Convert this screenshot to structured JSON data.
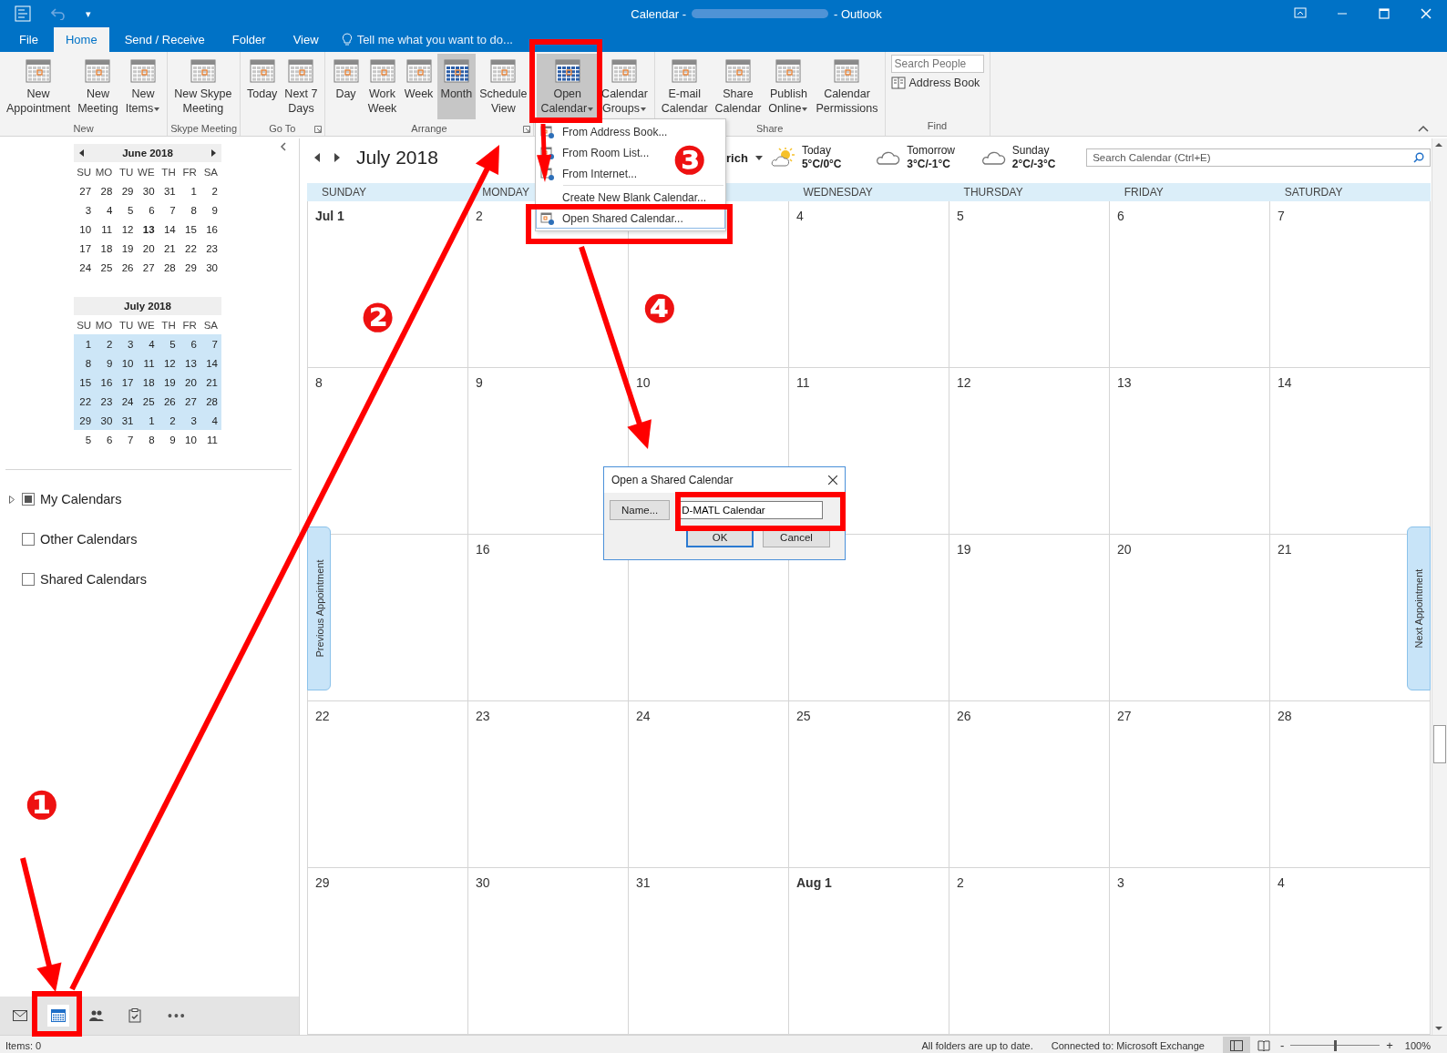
{
  "window": {
    "title_start": "Calendar -",
    "title_end": "- Outlook"
  },
  "quick_access": {
    "customize": "▾"
  },
  "tabs": [
    {
      "label": "File",
      "selected": false
    },
    {
      "label": "Home",
      "selected": true
    },
    {
      "label": "Send / Receive",
      "selected": false
    },
    {
      "label": "Folder",
      "selected": false
    },
    {
      "label": "View",
      "selected": false
    }
  ],
  "tell_me": {
    "placeholder": "Tell me what you want to do..."
  },
  "ribbon": {
    "groups": [
      {
        "label": "New",
        "launcher": false,
        "buttons": [
          {
            "lines": [
              "New",
              "Appointment"
            ],
            "menu": false,
            "selected": false
          },
          {
            "lines": [
              "New",
              "Meeting"
            ],
            "menu": false,
            "selected": false
          },
          {
            "lines": [
              "New",
              "Items"
            ],
            "menu": true,
            "selected": false
          }
        ]
      },
      {
        "label": "Skype Meeting",
        "launcher": false,
        "buttons": [
          {
            "lines": [
              "New Skype",
              "Meeting"
            ],
            "menu": false,
            "selected": false
          }
        ]
      },
      {
        "label": "Go To",
        "launcher": true,
        "buttons": [
          {
            "lines": [
              "Today"
            ],
            "menu": false,
            "selected": false
          },
          {
            "lines": [
              "Next 7",
              "Days"
            ],
            "menu": false,
            "selected": false
          }
        ]
      },
      {
        "label": "Arrange",
        "launcher": true,
        "buttons": [
          {
            "lines": [
              "Day"
            ],
            "menu": false,
            "selected": false
          },
          {
            "lines": [
              "Work",
              "Week"
            ],
            "menu": false,
            "selected": false
          },
          {
            "lines": [
              "Week"
            ],
            "menu": false,
            "selected": false
          },
          {
            "lines": [
              "Month"
            ],
            "menu": false,
            "selected": true
          },
          {
            "lines": [
              "Schedule",
              "View"
            ],
            "menu": false,
            "selected": false
          }
        ]
      },
      {
        "launcher": false,
        "buttons": [
          {
            "lines": [
              "Open",
              "Calendar"
            ],
            "menu": true,
            "selected": true
          },
          {
            "lines": [
              "Calendar",
              "Groups"
            ],
            "menu": true,
            "selected": false
          }
        ]
      },
      {
        "label": "Share",
        "launcher": false,
        "buttons": [
          {
            "lines": [
              "E-mail",
              "Calendar"
            ],
            "menu": false,
            "selected": false
          },
          {
            "lines": [
              "Share",
              "Calendar"
            ],
            "menu": false,
            "selected": false
          },
          {
            "lines": [
              "Publish",
              "Online"
            ],
            "menu": true,
            "selected": false
          },
          {
            "lines": [
              "Calendar",
              "Permissions"
            ],
            "menu": false,
            "selected": false
          }
        ]
      }
    ],
    "find": {
      "label": "Find",
      "placeholder": "Search People",
      "address_book": "Address Book"
    }
  },
  "dropdown_menu": {
    "items": [
      {
        "label": "From Address Book...",
        "icon": true,
        "separator_before": false,
        "selected": false
      },
      {
        "label": "From Room List...",
        "icon": true,
        "separator_before": false,
        "selected": false
      },
      {
        "label": "From Internet...",
        "icon": true,
        "separator_before": false,
        "selected": false
      },
      {
        "label": "Create New Blank Calendar...",
        "icon": false,
        "separator_before": true,
        "selected": false
      },
      {
        "label": "Open Shared Calendar...",
        "icon": true,
        "separator_before": false,
        "selected": true
      }
    ]
  },
  "sidebar": {
    "mini_calendars": [
      {
        "title": "June 2018",
        "nav": true,
        "weekdays": [
          "SU",
          "MO",
          "TU",
          "WE",
          "TH",
          "FR",
          "SA"
        ],
        "weeks": [
          {
            "selected": false,
            "days": [
              {
                "t": "27",
                "today": false
              },
              {
                "t": "28",
                "today": false
              },
              {
                "t": "29",
                "today": false
              },
              {
                "t": "30",
                "today": false
              },
              {
                "t": "31",
                "today": false
              },
              {
                "t": "1",
                "today": false
              },
              {
                "t": "2",
                "today": false
              }
            ]
          },
          {
            "selected": false,
            "days": [
              {
                "t": "3",
                "today": false
              },
              {
                "t": "4",
                "today": false
              },
              {
                "t": "5",
                "today": false
              },
              {
                "t": "6",
                "today": false
              },
              {
                "t": "7",
                "today": false
              },
              {
                "t": "8",
                "today": false
              },
              {
                "t": "9",
                "today": false
              }
            ]
          },
          {
            "selected": false,
            "days": [
              {
                "t": "10",
                "today": false
              },
              {
                "t": "11",
                "today": false
              },
              {
                "t": "12",
                "today": false
              },
              {
                "t": "13",
                "today": true
              },
              {
                "t": "14",
                "today": false
              },
              {
                "t": "15",
                "today": false
              },
              {
                "t": "16",
                "today": false
              }
            ]
          },
          {
            "selected": false,
            "days": [
              {
                "t": "17",
                "today": false
              },
              {
                "t": "18",
                "today": false
              },
              {
                "t": "19",
                "today": false
              },
              {
                "t": "20",
                "today": false
              },
              {
                "t": "21",
                "today": false
              },
              {
                "t": "22",
                "today": false
              },
              {
                "t": "23",
                "today": false
              }
            ]
          },
          {
            "selected": false,
            "days": [
              {
                "t": "24",
                "today": false
              },
              {
                "t": "25",
                "today": false
              },
              {
                "t": "26",
                "today": false
              },
              {
                "t": "27",
                "today": false
              },
              {
                "t": "28",
                "today": false
              },
              {
                "t": "29",
                "today": false
              },
              {
                "t": "30",
                "today": false
              }
            ]
          }
        ]
      },
      {
        "title": "July 2018",
        "nav": false,
        "weekdays": [
          "SU",
          "MO",
          "TU",
          "WE",
          "TH",
          "FR",
          "SA"
        ],
        "weeks": [
          {
            "selected": true,
            "days": [
              {
                "t": "1",
                "today": false
              },
              {
                "t": "2",
                "today": false
              },
              {
                "t": "3",
                "today": false
              },
              {
                "t": "4",
                "today": false
              },
              {
                "t": "5",
                "today": false
              },
              {
                "t": "6",
                "today": false
              },
              {
                "t": "7",
                "today": false
              }
            ]
          },
          {
            "selected": true,
            "days": [
              {
                "t": "8",
                "today": false
              },
              {
                "t": "9",
                "today": false
              },
              {
                "t": "10",
                "today": false
              },
              {
                "t": "11",
                "today": false
              },
              {
                "t": "12",
                "today": false
              },
              {
                "t": "13",
                "today": false
              },
              {
                "t": "14",
                "today": false
              }
            ]
          },
          {
            "selected": true,
            "days": [
              {
                "t": "15",
                "today": false
              },
              {
                "t": "16",
                "today": false
              },
              {
                "t": "17",
                "today": false
              },
              {
                "t": "18",
                "today": false
              },
              {
                "t": "19",
                "today": false
              },
              {
                "t": "20",
                "today": false
              },
              {
                "t": "21",
                "today": false
              }
            ]
          },
          {
            "selected": true,
            "days": [
              {
                "t": "22",
                "today": false
              },
              {
                "t": "23",
                "today": false
              },
              {
                "t": "24",
                "today": false
              },
              {
                "t": "25",
                "today": false
              },
              {
                "t": "26",
                "today": false
              },
              {
                "t": "27",
                "today": false
              },
              {
                "t": "28",
                "today": false
              }
            ]
          },
          {
            "selected": true,
            "days": [
              {
                "t": "29",
                "today": false
              },
              {
                "t": "30",
                "today": false
              },
              {
                "t": "31",
                "today": false
              },
              {
                "t": "1",
                "today": false
              },
              {
                "t": "2",
                "today": false
              },
              {
                "t": "3",
                "today": false
              },
              {
                "t": "4",
                "today": false
              }
            ]
          },
          {
            "selected": false,
            "days": [
              {
                "t": "5",
                "today": false
              },
              {
                "t": "6",
                "today": false
              },
              {
                "t": "7",
                "today": false
              },
              {
                "t": "8",
                "today": false
              },
              {
                "t": "9",
                "today": false
              },
              {
                "t": "10",
                "today": false
              },
              {
                "t": "11",
                "today": false
              }
            ]
          }
        ]
      }
    ],
    "folders": [
      {
        "label": "My Calendars",
        "checked": true,
        "expandable": true
      },
      {
        "label": "Other Calendars",
        "checked": false,
        "expandable": false
      },
      {
        "label": "Shared Calendars",
        "checked": false,
        "expandable": false
      }
    ]
  },
  "navigation": {
    "items": [
      {
        "selected": false
      },
      {
        "selected": true
      },
      {
        "selected": false
      },
      {
        "selected": false
      }
    ],
    "more": "•••"
  },
  "calendar": {
    "title": "July 2018",
    "location": "rich",
    "weather": [
      {
        "kind": "sunny",
        "day": "Today",
        "temp": "5°C/0°C"
      },
      {
        "kind": "cloudy",
        "day": "Tomorrow",
        "temp": "3°C/-1°C"
      },
      {
        "kind": "cloudy",
        "day": "Sunday",
        "temp": "2°C/-3°C"
      }
    ],
    "search": {
      "placeholder": "Search Calendar (Ctrl+E)"
    },
    "day_headers": [
      {
        "kind": "label",
        "text": "SUNDAY"
      },
      {
        "kind": "label",
        "text": "MONDAY"
      },
      {
        "kind": "covered"
      },
      {
        "kind": "label",
        "text": "WEDNESDAY"
      },
      {
        "kind": "label",
        "text": "THURSDAY"
      },
      {
        "kind": "label",
        "text": "FRIDAY"
      },
      {
        "kind": "label",
        "text": "SATURDAY"
      }
    ],
    "weeks": [
      [
        {
          "kind": "date",
          "t": "Jul 1",
          "month_start": true
        },
        {
          "kind": "date",
          "t": "2",
          "month_start": false
        },
        {
          "kind": "covered"
        },
        {
          "kind": "date",
          "t": "4",
          "month_start": false
        },
        {
          "kind": "date",
          "t": "5",
          "month_start": false
        },
        {
          "kind": "date",
          "t": "6",
          "month_start": false
        },
        {
          "kind": "date",
          "t": "7",
          "month_start": false
        }
      ],
      [
        {
          "kind": "date",
          "t": "8",
          "month_start": false
        },
        {
          "kind": "date",
          "t": "9",
          "month_start": false
        },
        {
          "kind": "date",
          "t": "10",
          "month_start": false
        },
        {
          "kind": "date",
          "t": "11",
          "month_start": false
        },
        {
          "kind": "date",
          "t": "12",
          "month_start": false
        },
        {
          "kind": "date",
          "t": "13",
          "month_start": false
        },
        {
          "kind": "date",
          "t": "14",
          "month_start": false
        }
      ],
      [
        {
          "kind": "covered"
        },
        {
          "kind": "date",
          "t": "16",
          "month_start": false
        },
        {
          "kind": "covered"
        },
        {
          "kind": "covered"
        },
        {
          "kind": "date",
          "t": "19",
          "month_start": false
        },
        {
          "kind": "date",
          "t": "20",
          "month_start": false
        },
        {
          "kind": "date",
          "t": "21",
          "month_start": false
        }
      ],
      [
        {
          "kind": "date",
          "t": "22",
          "month_start": false
        },
        {
          "kind": "date",
          "t": "23",
          "month_start": false
        },
        {
          "kind": "date",
          "t": "24",
          "month_start": false
        },
        {
          "kind": "date",
          "t": "25",
          "month_start": false
        },
        {
          "kind": "date",
          "t": "26",
          "month_start": false
        },
        {
          "kind": "date",
          "t": "27",
          "month_start": false
        },
        {
          "kind": "date",
          "t": "28",
          "month_start": false
        }
      ],
      [
        {
          "kind": "date",
          "t": "29",
          "month_start": false
        },
        {
          "kind": "date",
          "t": "30",
          "month_start": false
        },
        {
          "kind": "date",
          "t": "31",
          "month_start": false
        },
        {
          "kind": "date",
          "t": "Aug 1",
          "month_start": true
        },
        {
          "kind": "date",
          "t": "2",
          "month_start": false
        },
        {
          "kind": "date",
          "t": "3",
          "month_start": false
        },
        {
          "kind": "date",
          "t": "4",
          "month_start": false
        }
      ]
    ],
    "previous_appointment": "Previous Appointment",
    "next_appointment": "Next Appointment"
  },
  "dialog": {
    "title": "Open a Shared Calendar",
    "name_button": "Name...",
    "value": "D-MATL Calendar",
    "ok": "OK",
    "cancel": "Cancel"
  },
  "status_bar": {
    "items": "Items: 0",
    "sync": "All folders are up to date.",
    "connection": "Connected to: Microsoft Exchange",
    "zoom_out": "-",
    "zoom_in": "+",
    "zoom": {
      "level": 0.5
    },
    "zoom_text": "100%"
  },
  "annotations": {
    "step_numbers": [
      "❶",
      "❷",
      "❸",
      "❹"
    ]
  }
}
